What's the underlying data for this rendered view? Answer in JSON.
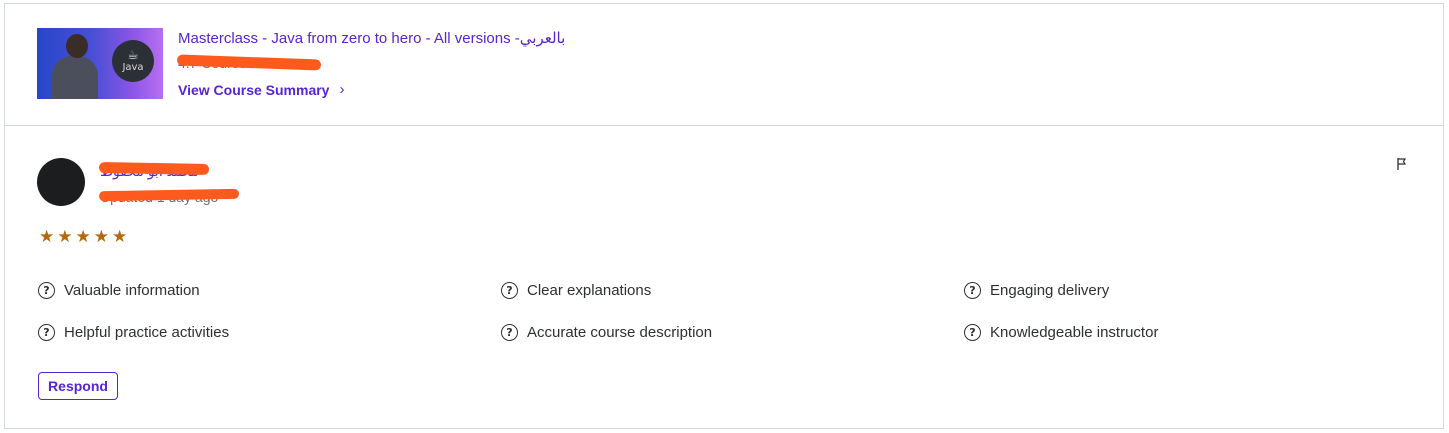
{
  "course": {
    "title": "Masterclass - Java from zero to hero - All versions -بالعربي",
    "rating_text": "4.7 Course Rating",
    "view_summary_label": "View Course Summary",
    "view_summary_chevron": "›",
    "thumbnail_logo_text": "Java"
  },
  "review": {
    "reviewer_name": "محمد ابو محفوظ",
    "updated_text": "Updated 1 day ago",
    "stars": [
      "★",
      "★",
      "★",
      "★",
      "★"
    ],
    "star_color": "#b4690e",
    "flag_icon": "flag-icon",
    "tags": [
      {
        "label": "Valuable information"
      },
      {
        "label": "Clear explanations"
      },
      {
        "label": "Engaging delivery"
      },
      {
        "label": "Helpful practice activities"
      },
      {
        "label": "Accurate course description"
      },
      {
        "label": "Knowledgeable instructor"
      }
    ],
    "tag_icon_glyph": "?",
    "respond_label": "Respond"
  },
  "colors": {
    "accent": "#5624d0",
    "redaction": "#fe5a1d",
    "border": "#d1d7dc"
  }
}
